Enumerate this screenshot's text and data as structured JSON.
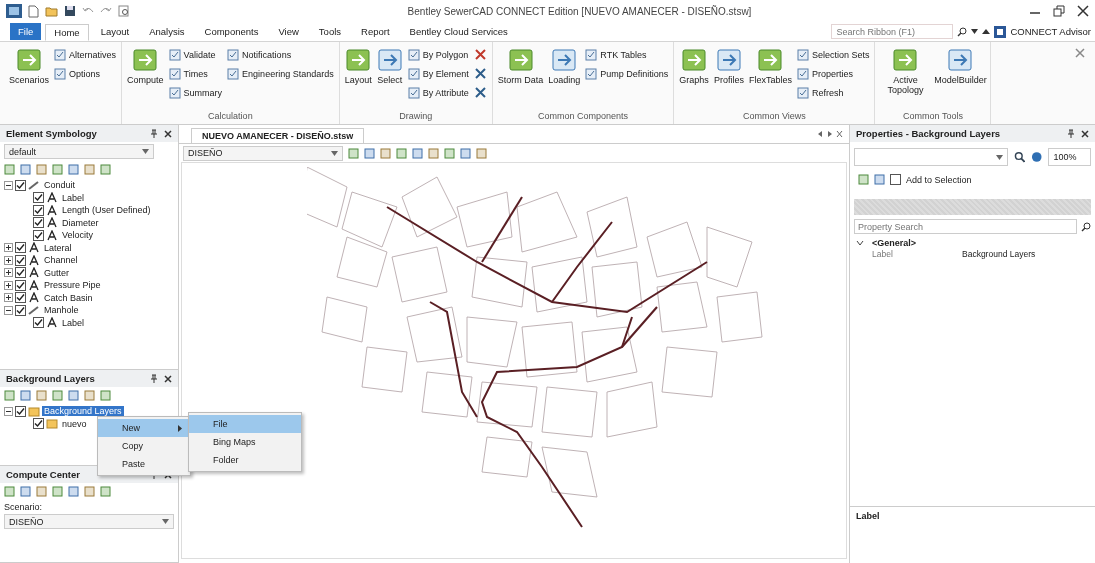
{
  "title_bar": {
    "title": "Bentley SewerCAD CONNECT Edition [NUEVO AMANECER - DISEÑO.stsw]"
  },
  "ribbon_tabs": [
    {
      "label": "File",
      "kind": "file",
      "selected": false
    },
    {
      "label": "Home",
      "kind": "tab",
      "selected": true
    },
    {
      "label": "Layout",
      "kind": "tab",
      "selected": false
    },
    {
      "label": "Analysis",
      "kind": "tab",
      "selected": false
    },
    {
      "label": "Components",
      "kind": "tab",
      "selected": false
    },
    {
      "label": "View",
      "kind": "tab",
      "selected": false
    },
    {
      "label": "Tools",
      "kind": "tab",
      "selected": false
    },
    {
      "label": "Report",
      "kind": "tab",
      "selected": false
    },
    {
      "label": "Bentley Cloud Services",
      "kind": "tab",
      "selected": false
    }
  ],
  "ribbon_search": {
    "placeholder": "Search Ribbon (F1)"
  },
  "account": {
    "label": "CONNECT Advisor"
  },
  "ribbon_groups": [
    {
      "items": [
        {
          "kind": "large",
          "label": "Scenarios"
        },
        {
          "kind": "small",
          "label": "Alternatives"
        },
        {
          "kind": "small",
          "label": "Options"
        }
      ]
    },
    {
      "label": "Calculation",
      "items": [
        {
          "kind": "large",
          "label": "Compute"
        },
        {
          "kind": "small",
          "label": "Validate"
        },
        {
          "kind": "small",
          "label": "Times"
        },
        {
          "kind": "small",
          "label": "Summary"
        },
        {
          "kind": "small",
          "label": "Notifications"
        },
        {
          "kind": "small",
          "label": "Engineering Standards"
        }
      ]
    },
    {
      "label": "Drawing",
      "items": [
        {
          "kind": "large",
          "label": "Layout"
        },
        {
          "kind": "large",
          "label": "Select"
        },
        {
          "kind": "small",
          "label": "By Polygon"
        },
        {
          "kind": "small",
          "label": "By Element"
        },
        {
          "kind": "small",
          "label": "By Attribute"
        },
        {
          "kind": "icon"
        },
        {
          "kind": "icon"
        },
        {
          "kind": "icon"
        }
      ]
    },
    {
      "label": "Common Components",
      "items": [
        {
          "kind": "large",
          "label": "Storm Data"
        },
        {
          "kind": "large",
          "label": "Loading"
        },
        {
          "kind": "small",
          "label": "RTK Tables"
        },
        {
          "kind": "small",
          "label": "Pump Definitions"
        }
      ]
    },
    {
      "label": "Common Views",
      "items": [
        {
          "kind": "large",
          "label": "Graphs"
        },
        {
          "kind": "large",
          "label": "Profiles"
        },
        {
          "kind": "large",
          "label": "FlexTables"
        },
        {
          "kind": "small",
          "label": "Selection Sets"
        },
        {
          "kind": "small",
          "label": "Properties"
        },
        {
          "kind": "small",
          "label": "Refresh"
        }
      ]
    },
    {
      "label": "Common Tools",
      "items": [
        {
          "kind": "large",
          "label": "Active Topology"
        },
        {
          "kind": "large",
          "label": "ModelBuilder"
        }
      ]
    }
  ],
  "symbology": {
    "title": "Element Symbology",
    "selector": "default",
    "tree": [
      {
        "label": "Conduit",
        "checked": true,
        "expanded": true,
        "children": [
          {
            "label": "Label",
            "checked": true
          },
          {
            "label": "Length (User Defined)",
            "checked": true
          },
          {
            "label": "Diameter",
            "checked": true
          },
          {
            "label": "Velocity",
            "checked": true
          }
        ]
      },
      {
        "label": "Lateral",
        "checked": true,
        "expanded": false
      },
      {
        "label": "Channel",
        "checked": true,
        "expanded": false
      },
      {
        "label": "Gutter",
        "checked": true,
        "expanded": false
      },
      {
        "label": "Pressure Pipe",
        "checked": true,
        "expanded": false
      },
      {
        "label": "Catch Basin",
        "checked": true,
        "expanded": false
      },
      {
        "label": "Manhole",
        "checked": true,
        "expanded": true,
        "children": [
          {
            "label": "Label",
            "checked": true
          }
        ]
      }
    ]
  },
  "background_layers": {
    "title": "Background Layers",
    "tree": [
      {
        "label": "Background Layers",
        "checked": true,
        "selected": true,
        "expanded": true,
        "children": [
          {
            "label": "nuevo",
            "checked": true,
            "selected": false
          }
        ]
      }
    ]
  },
  "context_menu": {
    "items": [
      {
        "label": "New",
        "selected": true,
        "submenu": true
      },
      {
        "label": "Copy",
        "selected": false,
        "submenu": false
      },
      {
        "label": "Paste",
        "selected": false,
        "submenu": false
      }
    ],
    "submenu": [
      {
        "label": "File",
        "selected": true
      },
      {
        "label": "Bing Maps",
        "selected": false
      },
      {
        "label": "Folder",
        "selected": false
      }
    ]
  },
  "compute_center": {
    "title": "Compute Center",
    "scenario_label": "Scenario:",
    "scenario": "DISEÑO"
  },
  "document": {
    "tab": "NUEVO AMANECER - DISEÑO.stsw",
    "scenario": "DISEÑO"
  },
  "properties": {
    "title": "Properties - Background Layers",
    "zoom": "100%",
    "add_to_selection": {
      "label": "Add to Selection",
      "checked": false
    },
    "search": {
      "placeholder": "Property Search"
    },
    "categories": [
      {
        "label": "<General>",
        "expanded": true,
        "rows": [
          {
            "name": "Label",
            "value": "Background Layers"
          }
        ]
      }
    ],
    "description": "Label"
  }
}
